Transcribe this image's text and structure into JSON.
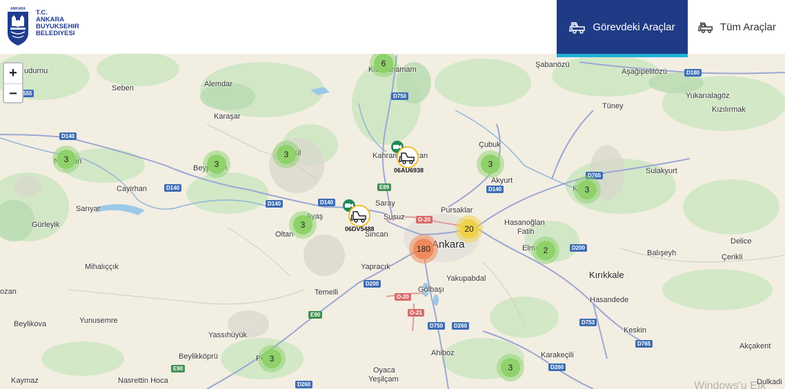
{
  "header": {
    "logo": {
      "top_text": "ANKARA",
      "lines": [
        "T.C.",
        "ANKARA",
        "BUYUKSEHIR",
        "BELEDIYESI"
      ]
    },
    "tabs": [
      {
        "label": "Görevdeki Araçlar",
        "active": true
      },
      {
        "label": "Tüm Araçlar",
        "active": false
      }
    ],
    "colors": {
      "active_tab": "#1f3b85",
      "active_underline": "#1fb0d8"
    }
  },
  "zoom": {
    "in": "+",
    "out": "−"
  },
  "clusters": [
    {
      "id": "c1",
      "count": "6"
    },
    {
      "id": "c2",
      "count": "3"
    },
    {
      "id": "c3",
      "count": "3"
    },
    {
      "id": "c4",
      "count": "3"
    },
    {
      "id": "c5",
      "count": "3"
    },
    {
      "id": "c6",
      "count": "3"
    },
    {
      "id": "c7",
      "count": "3"
    },
    {
      "id": "c8",
      "count": "20"
    },
    {
      "id": "c9",
      "count": "180"
    },
    {
      "id": "c10",
      "count": "2"
    },
    {
      "id": "c11",
      "count": "3"
    },
    {
      "id": "c12",
      "count": "3"
    }
  ],
  "vehicles": [
    {
      "plate": "06AU6938"
    },
    {
      "plate": "06DV5488"
    }
  ],
  "places": {
    "kizilcahamam": "Kızılcahamam",
    "sabanozu": "Şabanözü",
    "asagipelitozu": "Aşağıpelitözü",
    "sudurnu": "udurnu",
    "seben": "Seben",
    "alemdar": "Alemdar",
    "yukarialagoz": "Yukarıalagöz",
    "tuney": "Tüney",
    "kizilirmak": "Kızılırmak",
    "karasar": "Karaşar",
    "cubuk": "Çubuk",
    "kahramankazan": "Kahramankazan",
    "nallihan": "Nallıhan",
    "beypazari": "Beypazarı",
    "gudul": "Güdül",
    "sulakyurt": "Sulakyurt",
    "akyurt": "Akyurt",
    "cayirhan": "Cayirhan",
    "kalecik": "Kalecik",
    "sariyar": "Sarıyar",
    "saray": "Saray",
    "pursaklar": "Pursaklar",
    "gurleyik": "Gürleyik",
    "ayas": "Ayaş",
    "susuz": "Susuz",
    "hasanoglan": "Hasanoğlan",
    "fatih": "Fatih",
    "sincan": "Sincan",
    "oltan": "Oltan",
    "ankara": "Ankara",
    "elmadag": "Elmadağ",
    "delice": "Delice",
    "baliseyh": "Balışeyh",
    "cerikli": "Çerikli",
    "mihaliccik": "Mihalıççık",
    "yapracik": "Yapracık",
    "kirikkale": "Kırıkkale",
    "yakupabdal": "Yakupabdal",
    "gozan": "ozan",
    "temelli": "Temelli",
    "golbasi": "Gölbaşı",
    "hasandede": "Hasandede",
    "beylikova": "Beylikova",
    "yunusemre": "Yunusemre",
    "yassihuyuk": "Yassıhüyük",
    "keskin": "Keskin",
    "akcakent": "Akçakent",
    "beylikkopru": "Beylikköprü",
    "polatli": "Pola",
    "ahiboz": "Ahiboz",
    "karakecili": "Karakeçili",
    "bala": "ala",
    "kaymaz": "Kaymaz",
    "nasrettinhoca": "Nasrettin Hoca",
    "oyaca": "Oyaca",
    "yesilcam": "Yeşilçam",
    "dulkadi": "Dulkadi"
  },
  "road_shields": {
    "d750a": "D750",
    "d180": "D180",
    "d140a": "D140",
    "d140b": "D140",
    "d140c": "D140",
    "d140d": "D140",
    "d140e": "D140",
    "d765": "D765",
    "e89": "E89",
    "o20a": "O-20",
    "d200a": "D200",
    "d200b": "D200",
    "o20b": "O-20",
    "e90": "E90",
    "o21": "O-21",
    "d750b": "D750",
    "d260a": "D260",
    "d753": "D753",
    "d765b": "D765",
    "e90b": "E90",
    "d260b": "D260",
    "d260c": "D260",
    "d555": "555"
  },
  "watermark": "Windows'u Etk"
}
